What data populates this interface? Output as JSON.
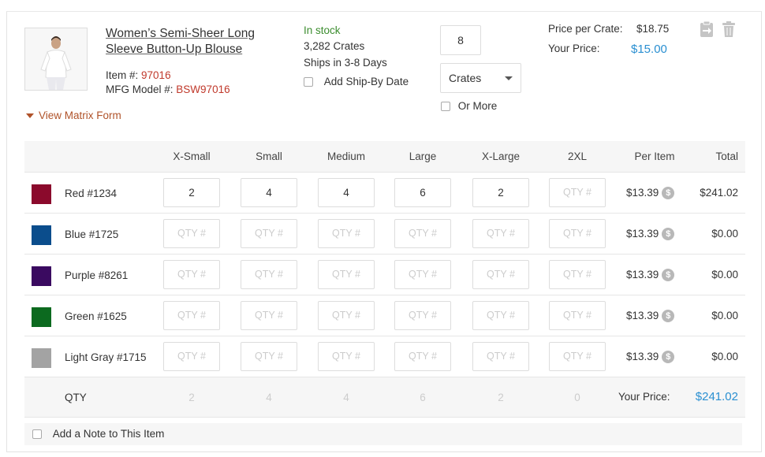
{
  "product": {
    "name_line1": "Women’s Semi-Sheer Long",
    "name_line2": "Sleeve Button-Up Blouse",
    "item_label": "Item #:",
    "item_value": "97016",
    "mfg_label": "MFG Model #:",
    "mfg_value": "BSW97016",
    "view_matrix": "View Matrix Form"
  },
  "stock": {
    "status": "In stock",
    "count": "3,282 Crates",
    "ships": "Ships in 3-8 Days",
    "ship_by_label": "Add Ship-By Date"
  },
  "order": {
    "quantity": "8",
    "unit": "Crates",
    "or_more": "Or More"
  },
  "pricing": {
    "per_crate_label": "Price per Crate:",
    "per_crate_value": "$18.75",
    "your_price_label": "Your Price:",
    "your_price_value": "$15.00"
  },
  "matrix": {
    "headers": [
      "X-Small",
      "Small",
      "Medium",
      "Large",
      "X-Large",
      "2XL",
      "Per Item",
      "Total"
    ],
    "placeholder": "QTY #",
    "rows": [
      {
        "color": "#8b0a2c",
        "name": "Red #1234",
        "qty": [
          "2",
          "4",
          "4",
          "6",
          "2",
          ""
        ],
        "per_item": "$13.39",
        "total": "$241.02"
      },
      {
        "color": "#0b4d8c",
        "name": "Blue #1725",
        "qty": [
          "",
          "",
          "",
          "",
          "",
          ""
        ],
        "per_item": "$13.39",
        "total": "$0.00"
      },
      {
        "color": "#3a0a60",
        "name": "Purple #8261",
        "qty": [
          "",
          "",
          "",
          "",
          "",
          ""
        ],
        "per_item": "$13.39",
        "total": "$0.00"
      },
      {
        "color": "#0c6a1f",
        "name": "Green #1625",
        "qty": [
          "",
          "",
          "",
          "",
          "",
          ""
        ],
        "per_item": "$13.39",
        "total": "$0.00"
      },
      {
        "color": "#a3a3a3",
        "name": "Light Gray #1715",
        "qty": [
          "",
          "",
          "",
          "",
          "",
          ""
        ],
        "per_item": "$13.39",
        "total": "$0.00"
      }
    ],
    "coin_symbol": "$",
    "footer_label": "QTY",
    "footer_qty": [
      "2",
      "4",
      "4",
      "6",
      "2",
      "0"
    ],
    "footer_price_label": "Your Price:",
    "footer_price_value": "$241.02"
  },
  "note": {
    "label": "Add a Note to This Item"
  },
  "icons": {
    "transfer": "clipboard-arrow-icon",
    "delete": "trash-icon"
  }
}
